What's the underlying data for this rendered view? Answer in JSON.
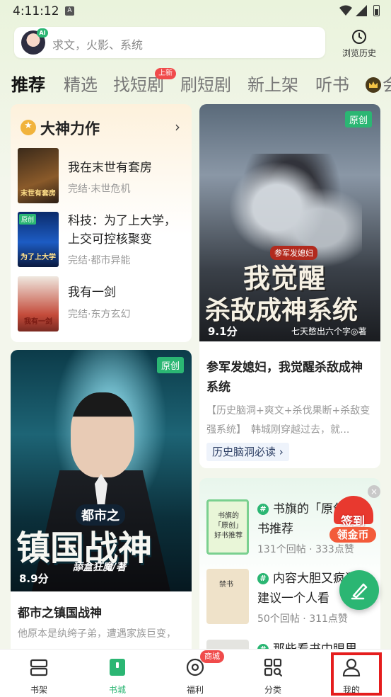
{
  "status": {
    "time": "4:11:12",
    "notif_icon": "A"
  },
  "search": {
    "ai_badge": "AI",
    "placeholder": "求文，火影、系统"
  },
  "history": {
    "label": "浏览历史"
  },
  "tabs": {
    "items": [
      "推荐",
      "精选",
      "找短剧",
      "刷短剧",
      "新上架",
      "听书"
    ],
    "new_badge": "上新",
    "cut_text": "会"
  },
  "dashen": {
    "title": "大神力作",
    "books": [
      {
        "name": "我在末世有套房",
        "meta": "完结·末世危机",
        "cover_text": "末世有套房"
      },
      {
        "name": "科技：为了上大学，上交可控核聚变",
        "meta": "完结·都市异能",
        "cover_text": "为了上大学",
        "badge": "原创"
      },
      {
        "name": "我有一剑",
        "meta": "完结·东方玄幻",
        "cover_text": "我有一剑"
      }
    ]
  },
  "feature1": {
    "badge": "原创",
    "cover_sub": "参军发媳妇",
    "cover_big1": "我觉醒",
    "cover_big2": "杀敌成神系统",
    "score": "9.1分",
    "cover_author": "七天憋出六个字◎著",
    "title": "参军发媳妇，我觉醒杀敌成神系统",
    "desc": "【历史脑洞+爽文+杀伐果断+杀敌变强系统】　韩城刚穿越过去，就...",
    "tag": "历史脑洞必读 ›"
  },
  "feature2": {
    "badge": "原创",
    "cover_pre": "都市之",
    "cover_big": "镇国战神",
    "cover_author": "舔盒狂魔/著",
    "score": "8.9分",
    "title": "都市之镇国战神",
    "desc": "他原本是纨绔子弟，遭遇家族巨变，"
  },
  "topics": {
    "items": [
      {
        "title": "书旗的「原创」好书推荐",
        "stat_posts": "131个回帖",
        "stat_likes": "333点赞",
        "thumb_text": "书旗的「原创」好书推荐"
      },
      {
        "title": "内容大胆又疯狂，建议一个人看",
        "stat_posts": "50个回帖",
        "stat_likes": "311点赞",
        "thumb_text": "禁书"
      },
      {
        "title": "那些看书中眼里",
        "stat_posts": "",
        "stat_likes": "",
        "thumb_text": ""
      }
    ]
  },
  "floating": {
    "signin_top": "签到",
    "signin_bottom": "领金币",
    "close": "×"
  },
  "bottom_nav": {
    "items": [
      {
        "label": "书架",
        "icon": "bookshelf-icon"
      },
      {
        "label": "书城",
        "icon": "bookstore-icon"
      },
      {
        "label": "福利",
        "icon": "welfare-icon"
      },
      {
        "label": "分类",
        "icon": "category-icon"
      },
      {
        "label": "我的",
        "icon": "profile-icon"
      }
    ],
    "mall_badge": "商城",
    "active": "书城"
  },
  "colors": {
    "accent": "#2bb673",
    "badge_red": "#f04b4b",
    "highlight": "#e51d1d"
  }
}
